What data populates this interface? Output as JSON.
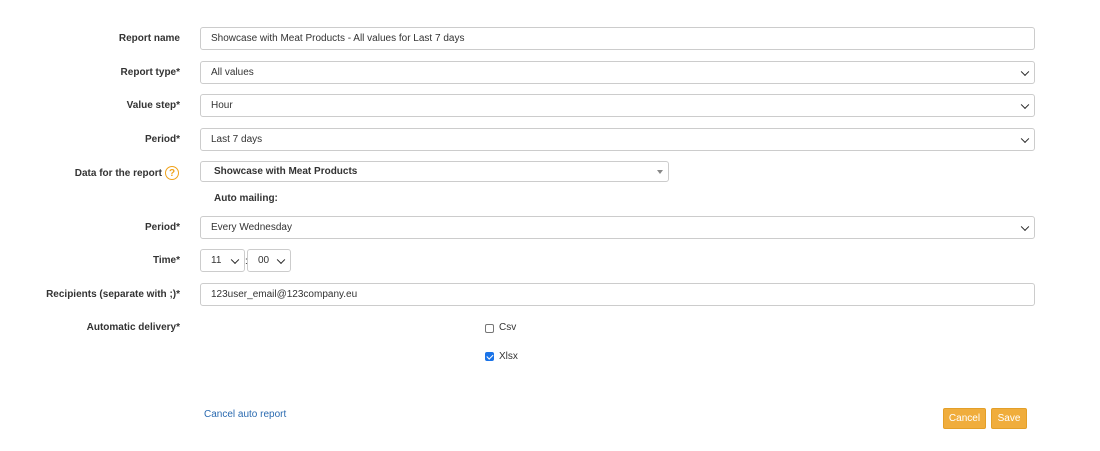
{
  "form": {
    "report_name": {
      "label": "Report name",
      "value": "Showcase with Meat Products - All values for Last 7 days"
    },
    "report_type": {
      "label": "Report type*",
      "value": "All values"
    },
    "value_step": {
      "label": "Value step*",
      "value": "Hour"
    },
    "period": {
      "label": "Period*",
      "value": "Last 7 days"
    },
    "data_for_report": {
      "label": "Data for the report",
      "value": "Showcase with Meat Products",
      "help_icon": "?"
    },
    "auto_mailing": {
      "heading": "Auto mailing:",
      "period": {
        "label": "Period*",
        "value": "Every Wednesday"
      },
      "time": {
        "label": "Time*",
        "hour": "11",
        "separator": ":",
        "minute": "00"
      },
      "recipients": {
        "label": "Recipients (separate with ;)*",
        "value": "123user_email@123company.eu"
      },
      "automatic_delivery": {
        "label": "Automatic delivery*",
        "options": [
          {
            "label": "Csv",
            "checked": false
          },
          {
            "label": "Xlsx",
            "checked": true
          }
        ]
      }
    }
  },
  "actions": {
    "cancel_auto_report": "Cancel auto report",
    "cancel": "Cancel",
    "save": "Save"
  },
  "colors": {
    "accent": "#f0ad3c",
    "link": "#2a6ab0",
    "help": "#f0a31b",
    "checkbox": "#1a73e8"
  }
}
